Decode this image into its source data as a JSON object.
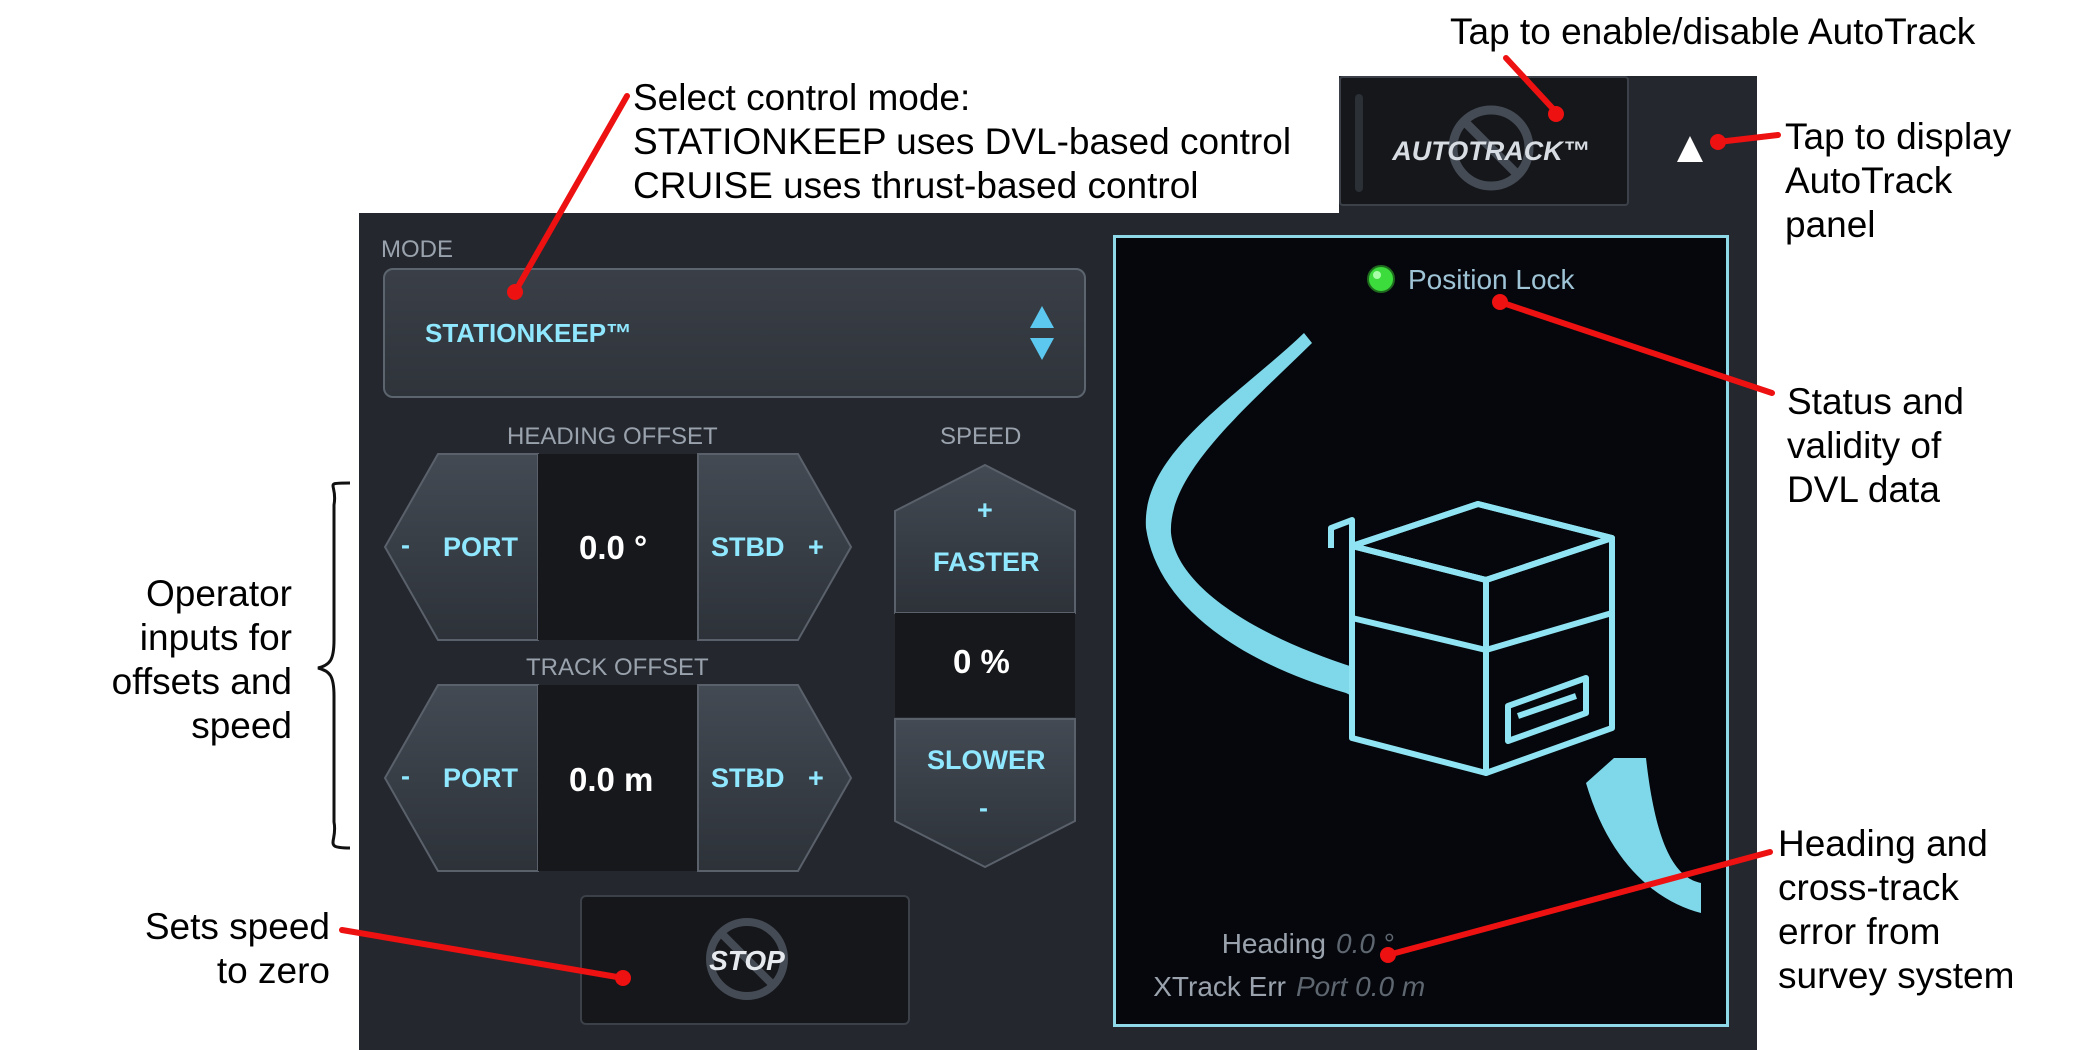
{
  "callouts": {
    "autotrack_toggle": "Tap to enable/disable AutoTrack",
    "control_mode": "Select control mode:\nSTATIONKEEP uses DVL-based control\nCRUISE uses thrust-based control",
    "display_panel": "Tap to display\nAutoTrack\npanel",
    "status": "Status and\nvalidity of\nDVL data",
    "operator_inputs": "Operator\ninputs for\noffsets and\nspeed",
    "heading_error": "Heading and\ncross-track\nerror from\nsurvey system",
    "stop": "Sets speed\nto zero"
  },
  "mode": {
    "label": "MODE",
    "value": "STATIONKEEP™"
  },
  "heading_offset": {
    "label": "HEADING OFFSET",
    "port": "PORT",
    "stbd": "STBD",
    "minus": "-",
    "plus": "+",
    "value": "0.0 °"
  },
  "track_offset": {
    "label": "TRACK OFFSET",
    "port": "PORT",
    "stbd": "STBD",
    "minus": "-",
    "plus": "+",
    "value": "0.0 m"
  },
  "speed": {
    "label": "SPEED",
    "faster": "FASTER",
    "slower": "SLOWER",
    "plus": "+",
    "minus": "-",
    "value": "0 %"
  },
  "stop_label": "STOP",
  "autotrack_label": "AUTOTRACK™",
  "panel_toggle_icon": "triangle-up-icon",
  "status": {
    "label": "Position Lock",
    "color": "#3ddc3d"
  },
  "readout": {
    "heading_label": "Heading",
    "heading_value": "0.0 °",
    "xtrack_label": "XTrack Err",
    "xtrack_value": "Port 0.0 m"
  },
  "colors": {
    "accent": "#8fe8ff",
    "panel": "#24272d",
    "callout_line": "#ee1111"
  }
}
